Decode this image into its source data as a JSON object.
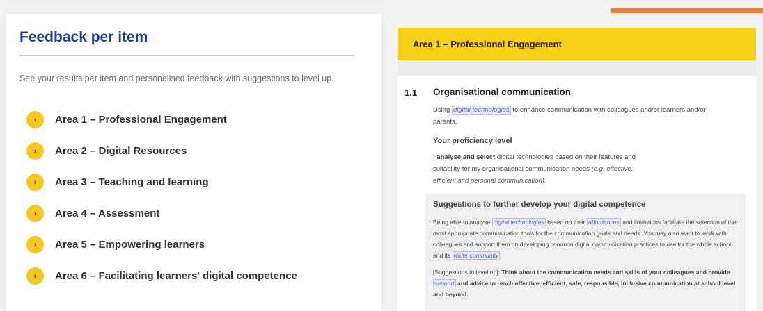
{
  "left": {
    "title": "Feedback per item",
    "intro": "See your results per item and personalised feedback with suggestions to level up.",
    "bullet_glyph": "›",
    "areas": [
      "Area 1 – Professional Engagement",
      "Area 2 – Digital Resources",
      "Area 3 – Teaching and learning",
      "Area 4 – Assessment",
      "Area 5 – Empowering learners",
      "Area 6 – Facilitating learners' digital competence"
    ]
  },
  "right": {
    "header": "Area 1 – Professional Engagement",
    "section_number": "1.1",
    "section_title": "Organisational communication",
    "desc_pre": "Using ",
    "desc_link": "digital technologies",
    "desc_post": " to enhance communication with colleagues and/or learners and/or parents.",
    "proficiency_heading": "Your proficiency level",
    "prof_pre": "I ",
    "prof_bold": "analyse and select",
    "prof_mid": " digital technologies based on their features and suitability for my organisational communication needs ",
    "prof_italic": "(e.g. effective, efficient and personal communication).",
    "suggestions_heading": "Suggestions to further develop your digital competence",
    "sugg_p1_a": "Being able to analyse ",
    "sugg_p1_link1": "digital technologies",
    "sugg_p1_b": " based on their ",
    "sugg_p1_link2": "affordances",
    "sugg_p1_c": " and limitations facilitate the selection of the most appropriate communication tools for the communication goals and needs. You may also want to work with colleagues and support them on developing common digital communication practices to use for the whole school and its ",
    "sugg_p1_link3": "wider community",
    "sugg_p1_d": ".",
    "sugg_p2_a": "[Suggestions to level up]: ",
    "sugg_p2_bold1": "Think about the communication needs and skills of your colleagues and provide ",
    "sugg_p2_link": "support",
    "sugg_p2_bold2": " and advice to reach effective, efficient, safe, responsible, inclusive communication at school level and beyond."
  },
  "colors": {
    "accent_orange": "#ee7d3b",
    "title_blue": "#1f3f8f",
    "yellow": "#f7d117",
    "bullet_yellow": "#f6c81e"
  }
}
